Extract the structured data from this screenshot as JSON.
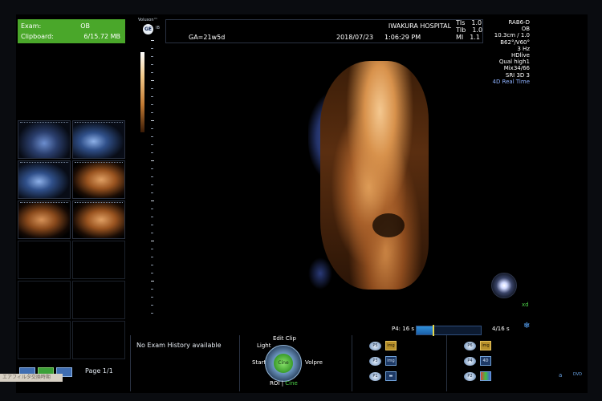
{
  "exam": {
    "exam_label": "Exam:",
    "exam_value": "OB",
    "clipboard_label": "Clipboard:",
    "clipboard_value": "6/15.72 MB"
  },
  "header": {
    "logo_text": "Voluson™",
    "ge_text": "GE",
    "ib_text": "IB",
    "hospital": "IWAKURA HOSPITAL",
    "ga": "GA=21w5d",
    "date": "2018/07/23",
    "time": "1:06:29 PM",
    "tis_label": "TIs",
    "tis_value": "1.0",
    "tib_label": "TIb",
    "tib_value": "1.0",
    "mi_label": "MI",
    "mi_value": "1.1"
  },
  "params": {
    "probe": "RAB6-D",
    "preset": "OB",
    "depth": "10.3cm / 1.0",
    "angle": "B62°/V60°",
    "rate": "3 Hz",
    "render1": "HDlive",
    "quality": "Qual high1",
    "mix": "Mix34/66",
    "sri": "SRI 3D 3",
    "mode": "4D Real Time"
  },
  "cine": {
    "p4_label": "P4:",
    "p4_value": "16 s",
    "count": "4/16 s",
    "progress": 0.25
  },
  "history": {
    "text": "No Exam History available"
  },
  "pager": {
    "label": "Page 1/1"
  },
  "dial": {
    "top": "Edit Clip",
    "left_top": "Light",
    "left": "Start",
    "center": "Cine",
    "right": "Volpre",
    "roi": "ROI",
    "sep": "|",
    "cine": "Cine"
  },
  "pgroup1": {
    "p5": "P5",
    "p3": "P3",
    "p1": "P1",
    "img_p5": "img",
    "img_p3": "img"
  },
  "pgroup2": {
    "p6": "P6",
    "p4": "P4",
    "p2": "P2",
    "img_p6": "img",
    "d4": "4D"
  },
  "icons_right": {
    "xd": "xd",
    "a": "a",
    "dvd": "DVD"
  },
  "ime": {
    "text": "エアフィルタ交換時期"
  }
}
